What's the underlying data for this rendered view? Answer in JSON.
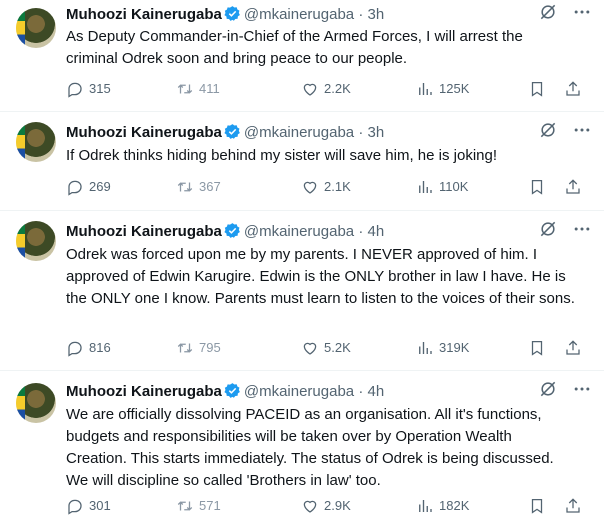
{
  "colors": {
    "text": "#0f1419",
    "muted": "#536471",
    "verified": "#1d9bf0",
    "divider": "#eff3f4"
  },
  "tweets": [
    {
      "name": "Muhoozi Kainerugaba",
      "handle": "@mkainerugaba",
      "dot": "·",
      "time": "3h",
      "text": "As Deputy Commander-in-Chief of the Armed Forces, I will arrest the criminal Odrek soon and bring peace to our people.",
      "replies": "315",
      "retweets": "411",
      "likes": "2.2K",
      "views": "125K"
    },
    {
      "name": "Muhoozi Kainerugaba",
      "handle": "@mkainerugaba",
      "dot": "·",
      "time": "3h",
      "text": "If Odrek thinks hiding behind my sister will save him, he is joking!",
      "replies": "269",
      "retweets": "367",
      "likes": "2.1K",
      "views": "110K"
    },
    {
      "name": "Muhoozi Kainerugaba",
      "handle": "@mkainerugaba",
      "dot": "·",
      "time": "4h",
      "text": "Odrek was forced upon me by my parents. I NEVER approved of him. I approved of Edwin Karugire. Edwin is the ONLY brother in law I have. He is the ONLY one I know. Parents must learn to listen to the voices of their sons.",
      "replies": "816",
      "retweets": "795",
      "likes": "5.2K",
      "views": "319K"
    },
    {
      "name": "Muhoozi Kainerugaba",
      "handle": "@mkainerugaba",
      "dot": "·",
      "time": "4h",
      "text": "We are officially dissolving PACEID as an organisation. All it's functions, budgets and responsibilities will be taken over by Operation Wealth Creation. This starts immediately. The status of Odrek is being discussed. We will discipline so called 'Brothers in law' too.",
      "replies": "301",
      "retweets": "571",
      "likes": "2.9K",
      "views": "182K"
    }
  ]
}
